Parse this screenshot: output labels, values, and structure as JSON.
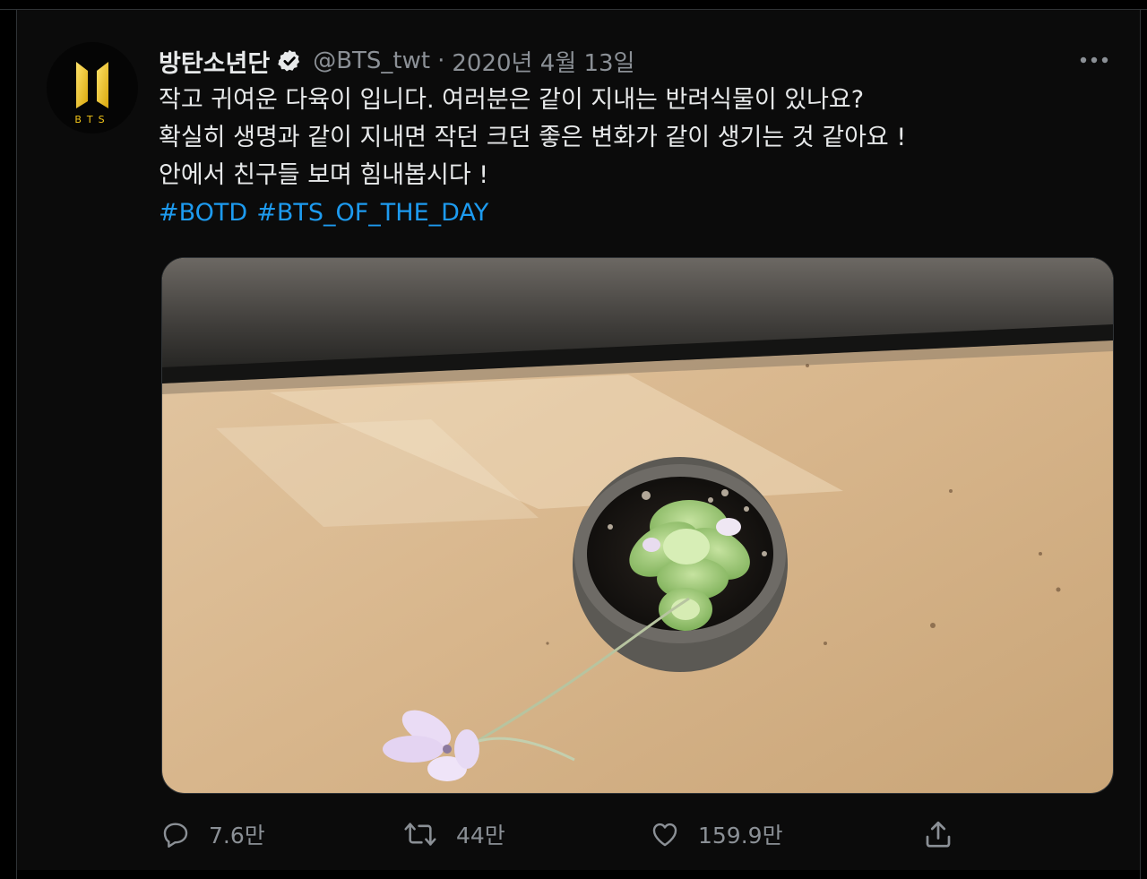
{
  "tweet": {
    "display_name": "방탄소년단",
    "handle": "@BTS_twt",
    "separator": "·",
    "date": "2020년 4월 13일",
    "lines": [
      "작고 귀여운 다육이 입니다. 여러분은 같이 지내는 반려식물이 있나요?",
      "확실히 생명과 같이 지내면 작던 크던 좋은 변화가 같이 생기는 것 같아요 !",
      "안에서 친구들 보며 힘내봅시다 !"
    ],
    "hashtags": [
      "#BOTD",
      "#BTS_OF_THE_DAY"
    ],
    "avatar_text": "BTS",
    "image_alt": "succulent in a small pot on a wooden table"
  },
  "actions": {
    "reply_count": "7.6만",
    "retweet_count": "44만",
    "like_count": "159.9만"
  },
  "icons": {
    "more": "more-horizontal-icon",
    "verified": "verified-badge-icon",
    "reply": "reply-bubble-icon",
    "retweet": "retweet-icon",
    "like": "heart-icon",
    "share": "share-upload-icon"
  },
  "colors": {
    "background": "#000000",
    "text": "#e7e9ea",
    "muted": "#8b9096",
    "link": "#1d9bf0",
    "brand_gold": "#f3c619"
  }
}
